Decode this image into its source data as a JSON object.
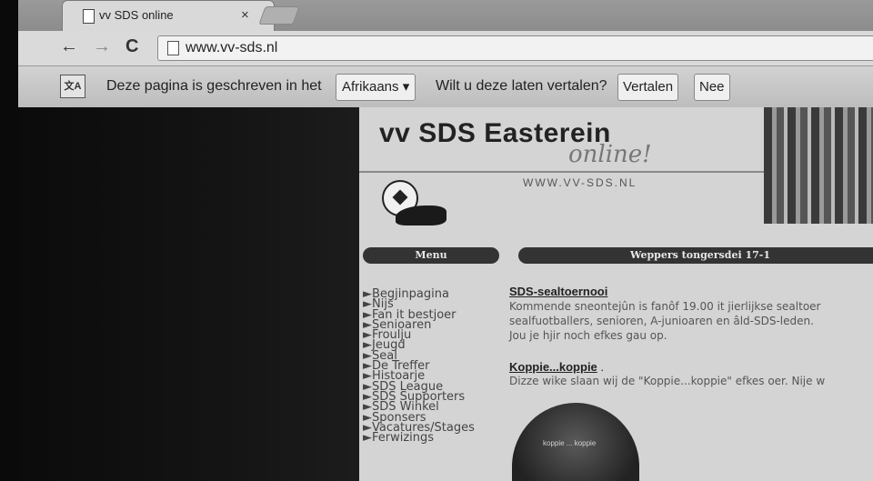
{
  "browser": {
    "tab_title": "vv SDS online",
    "tab_close": "×",
    "url": "www.vv-sds.nl",
    "nav": {
      "back": "←",
      "forward": "→",
      "reload": "C"
    }
  },
  "translate_bar": {
    "message": "Deze pagina is geschreven in het",
    "language": "Afrikaans ▾",
    "question": "Wilt u deze laten vertalen?",
    "translate_label": "Vertalen",
    "no_label": "Nee"
  },
  "site": {
    "title": "vv SDS Easterein",
    "tagline": "online!",
    "web_url": "WWW.VV-SDS.NL",
    "menu_header": "Menu",
    "news_header": "Weppers tongersdei 17-1",
    "menu": [
      "►Begjinpagina",
      "►Nijs",
      "►Fan it bestjoer",
      "►Senioaren",
      "►Froulju",
      "►Jeugd",
      "►Seal",
      "►De Treffer",
      "►Histoarje",
      "►SDS League",
      "►SDS Supporters",
      "►SDS Winkel",
      "►Sponsers",
      "►Vacatures/Stages",
      "►Ferwizings"
    ],
    "news": [
      {
        "title": "SDS-sealtoernooi",
        "lines": [
          "Kommende sneontejûn is fanôf 19.00 it jierlijkse sealtoer",
          "sealfuotballers, senioren, A-junioaren en âld-SDS-leden.",
          "Jou je hjir noch efkes gau op."
        ]
      },
      {
        "title": "Koppie...koppie",
        "after_title": " .",
        "lines": [
          "Dizze wike slaan wij de \"Koppie...koppie\" efkes oer. Nije w"
        ]
      }
    ],
    "cap_text": "koppie ... koppie"
  }
}
